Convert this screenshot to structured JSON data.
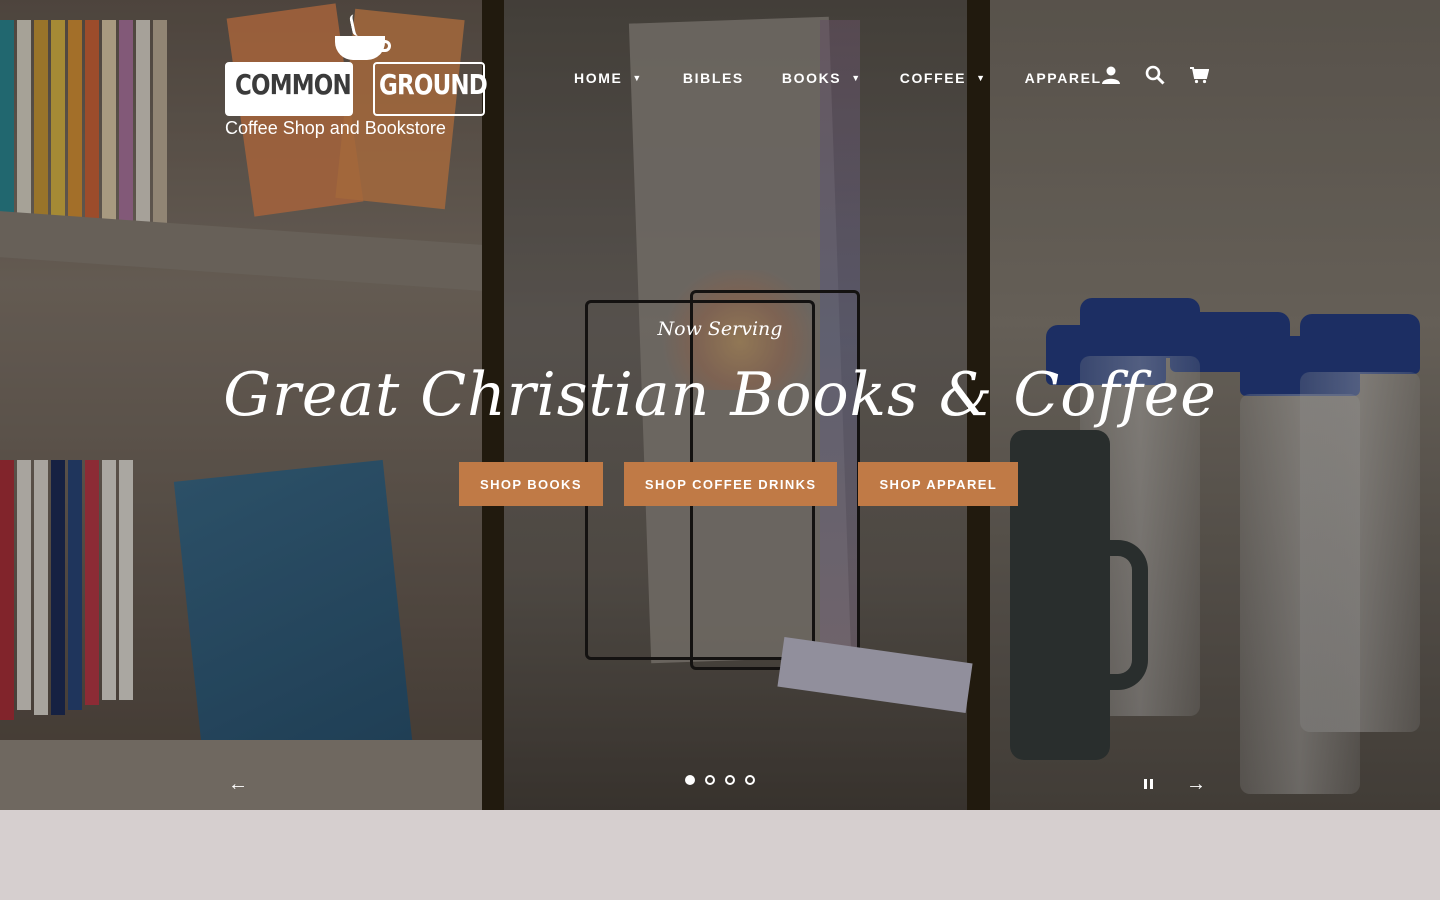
{
  "brand": {
    "word_left": "COMMON",
    "word_right": "GROUND",
    "tagline": "Coffee Shop and Bookstore"
  },
  "nav": {
    "items": [
      {
        "label": "HOME",
        "has_dropdown": true
      },
      {
        "label": "BIBLES",
        "has_dropdown": false
      },
      {
        "label": "BOOKS",
        "has_dropdown": true
      },
      {
        "label": "COFFEE",
        "has_dropdown": true
      },
      {
        "label": "APPAREL",
        "has_dropdown": false
      }
    ],
    "icons": [
      "account-icon",
      "search-icon",
      "cart-icon"
    ]
  },
  "hero": {
    "subtitle": "Now Serving",
    "title": "Great Christian Books & Coffee",
    "buttons": [
      "SHOP BOOKS",
      "SHOP COFFEE DRINKS",
      "SHOP APPAREL"
    ]
  },
  "slideshow": {
    "slide_count": 4,
    "active_index": 0,
    "prev_glyph": "←",
    "next_glyph": "→"
  },
  "colors": {
    "accent": "#c07a46",
    "page_background": "#d6cfcf"
  }
}
